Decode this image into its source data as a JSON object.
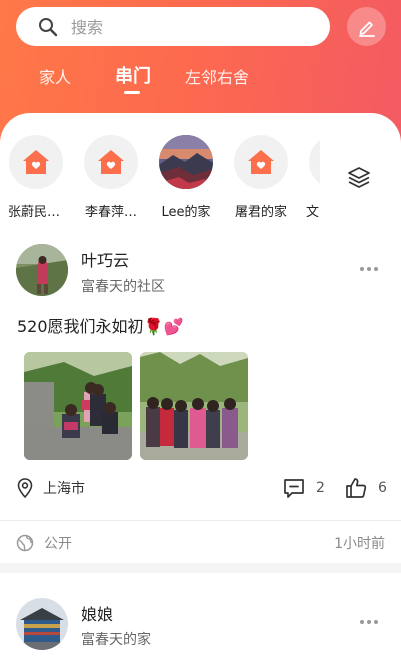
{
  "search": {
    "placeholder": "搜索"
  },
  "tabs": [
    {
      "label": "家人"
    },
    {
      "label": "串门",
      "active": true
    },
    {
      "label": "左邻右舍"
    }
  ],
  "stories": [
    {
      "name": "张蔚民…",
      "icon": "house-icon"
    },
    {
      "name": "李春萍…",
      "icon": "house-icon"
    },
    {
      "name": "Lee的家",
      "icon": "photo"
    },
    {
      "name": "屠君的家",
      "icon": "house-icon"
    },
    {
      "name": "文",
      "icon": "house-icon"
    }
  ],
  "posts": [
    {
      "author": "叶巧云",
      "community": "富春天的社区",
      "text": "520愿我们永如初🌹💕",
      "location": "上海市",
      "comments": "2",
      "likes": "6",
      "visibility": "公开",
      "time": "1小时前"
    },
    {
      "author": "娘娘",
      "community": "富春天的家"
    }
  ],
  "colors": {
    "accent": "#fd6a4e",
    "accent_end": "#f35a63"
  }
}
